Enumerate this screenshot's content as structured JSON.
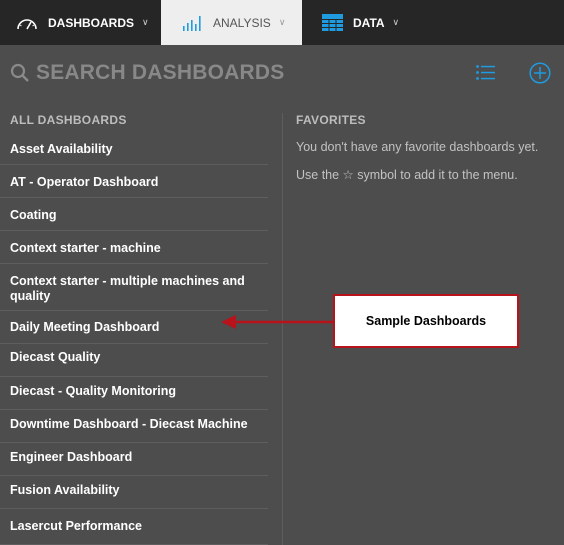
{
  "nav": {
    "dashboards_label": "DASHBOARDS",
    "analysis_label": "ANALYSIS",
    "data_label": "DATA",
    "chevron": "∨"
  },
  "search": {
    "placeholder": "SEARCH DASHBOARDS",
    "accent_color": "#1f9be0"
  },
  "all_dashboards": {
    "heading": "ALL DASHBOARDS",
    "items": [
      "Asset Availability",
      "AT - Operator Dashboard",
      "Coating",
      "Context starter - machine",
      "Context starter - multiple machines and quality",
      "Daily Meeting Dashboard",
      "Diecast Quality",
      "Diecast - Quality Monitoring",
      "Downtime Dashboard - Diecast Machine",
      "Engineer Dashboard",
      "Fusion Availability",
      "Lasercut Performance"
    ]
  },
  "favorites": {
    "heading": "FAVORITES",
    "empty_text": "You don't have any favorite dashboards yet.",
    "hint_text": "Use the ☆ symbol to add it to the menu."
  },
  "annotation": {
    "callout_text": "Sample Dashboards",
    "callout_color": "#b8121b"
  },
  "icons": [
    "gauge-icon",
    "bar-chart-icon",
    "grid-table-icon",
    "search-icon",
    "list-icon",
    "add-circle-icon",
    "arrow-left-icon"
  ]
}
